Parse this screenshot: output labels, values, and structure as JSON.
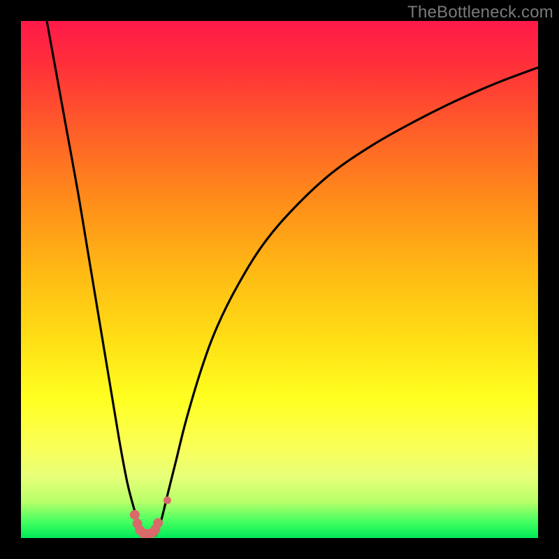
{
  "attribution": "TheBottleneck.com",
  "chart_data": {
    "type": "line",
    "title": "",
    "xlabel": "",
    "ylabel": "",
    "xlim": [
      0,
      100
    ],
    "ylim": [
      0,
      100
    ],
    "grid": false,
    "legend": false,
    "background_gradient": {
      "top_color": "#ff1a4a",
      "bottom_color": "#00e858",
      "mid_colors": [
        "#ff8a1a",
        "#ffe015",
        "#ffff20"
      ]
    },
    "series": [
      {
        "name": "left-curve",
        "stroke": "#000000",
        "x": [
          5,
          7,
          9,
          11,
          13,
          15,
          17,
          19,
          20.5,
          21.5,
          22.5,
          23,
          23.5
        ],
        "y": [
          100,
          89,
          78,
          67,
          55,
          43,
          31,
          19,
          11,
          7,
          3.5,
          1.5,
          0.5
        ]
      },
      {
        "name": "right-curve",
        "stroke": "#000000",
        "x": [
          26,
          27,
          28.5,
          30,
          32,
          35,
          38,
          42,
          47,
          53,
          60,
          68,
          76,
          84,
          92,
          100
        ],
        "y": [
          0.5,
          3,
          9,
          15,
          23,
          33,
          41,
          49,
          57,
          64,
          70.5,
          76,
          80.5,
          84.5,
          88,
          91
        ]
      },
      {
        "name": "highlight-dots",
        "stroke": "#d86a6a",
        "type": "scatter",
        "x": [
          22.0,
          22.5,
          23.0,
          23.7,
          24.5,
          25.4,
          26.0,
          26.5,
          28.3
        ],
        "y": [
          4.5,
          2.8,
          1.5,
          0.9,
          0.8,
          1.0,
          1.7,
          2.9,
          7.3
        ],
        "r": [
          7,
          7,
          7,
          7,
          7,
          7,
          7,
          7,
          5.5
        ]
      }
    ]
  }
}
